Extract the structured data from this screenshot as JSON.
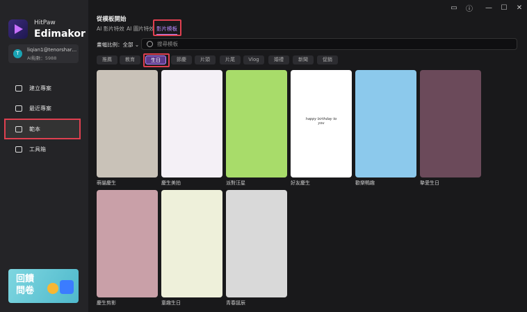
{
  "app": {
    "brand_line1": "HitPaw",
    "brand_line2": "Edimakor"
  },
  "user": {
    "avatar_letter": "T",
    "email": "liqian1@tenorshare...",
    "ai_points": "AI點數：5988"
  },
  "sidebar": {
    "items": [
      {
        "label": "建立專案",
        "icon": "plus-square-icon"
      },
      {
        "label": "最近專案",
        "icon": "folder-icon"
      },
      {
        "label": "範本",
        "icon": "template-icon",
        "active": true
      },
      {
        "label": "工具箱",
        "icon": "toolbox-icon"
      }
    ],
    "banner": "回饋問卷"
  },
  "header": {
    "title": "從模板開始",
    "tabs": [
      "AI 影片特效",
      "AI 圖片特效",
      "影片模板"
    ],
    "active_tab": "影片模板"
  },
  "filter": {
    "ratio_label": "畫幅比例：全部",
    "search_placeholder": "搜尋模板"
  },
  "categories": [
    "推薦",
    "教育",
    "生日",
    "節慶",
    "片頭",
    "片尾",
    "Vlog",
    "婚禮",
    "新聞",
    "促銷"
  ],
  "active_category": "生日",
  "templates": [
    {
      "label": "萌貓慶生",
      "color": "#c9c2b8"
    },
    {
      "label": "慶生美拍",
      "color": "#f4f0f6"
    },
    {
      "label": "派對汪星",
      "color": "#a8dc6a"
    },
    {
      "label": "好友慶生",
      "color": "#ffffff",
      "text": "happy birthday to you"
    },
    {
      "label": "歡樂鴨趣",
      "color": "#8cc9ec"
    },
    {
      "label": "摯愛生日",
      "color": "#6b4a5a"
    },
    {
      "label": "慶生剪影",
      "color": "#c9a0a8"
    },
    {
      "label": "童趣生日",
      "color": "#eef0da"
    },
    {
      "label": "青春誕辰",
      "color": "#d9d9d9"
    }
  ],
  "window_controls": [
    "feedback-icon",
    "help-icon",
    "minimize-icon",
    "maximize-icon",
    "close-icon"
  ]
}
